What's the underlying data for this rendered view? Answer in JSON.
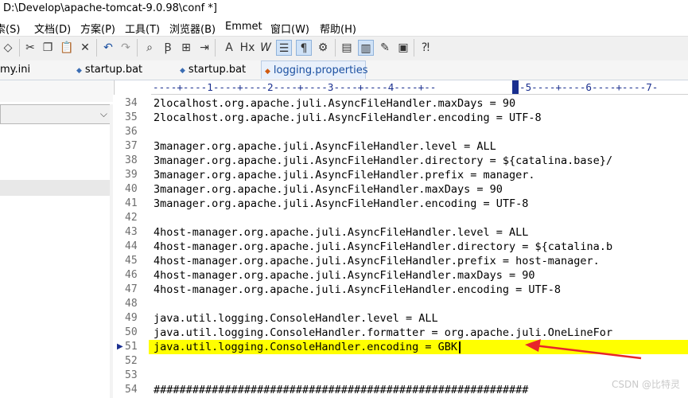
{
  "window": {
    "title": "D:\\Develop\\apache-tomcat-9.0.98\\conf *]"
  },
  "menu": [
    "索(S)",
    "文档(D)",
    "方案(P)",
    "工具(T)",
    "浏览器(B)",
    "Emmet",
    "窗口(W)",
    "帮助(H)"
  ],
  "tabs": [
    {
      "label": "my.ini"
    },
    {
      "label": "startup.bat"
    },
    {
      "label": "startup.bat"
    },
    {
      "label": "logging.properties"
    }
  ],
  "ruler": "----+----1----+----2----+----3----+----4----+--",
  "ruler_after": "-5----+----6----+----7-",
  "lines": [
    {
      "n": "34",
      "text": "2localhost.org.apache.juli.AsyncFileHandler.maxDays = 90"
    },
    {
      "n": "35",
      "text": "2localhost.org.apache.juli.AsyncFileHandler.encoding = UTF-8"
    },
    {
      "n": "36",
      "text": ""
    },
    {
      "n": "37",
      "text": "3manager.org.apache.juli.AsyncFileHandler.level = ALL"
    },
    {
      "n": "38",
      "text": "3manager.org.apache.juli.AsyncFileHandler.directory = ${catalina.base}/"
    },
    {
      "n": "39",
      "text": "3manager.org.apache.juli.AsyncFileHandler.prefix = manager."
    },
    {
      "n": "40",
      "text": "3manager.org.apache.juli.AsyncFileHandler.maxDays = 90"
    },
    {
      "n": "41",
      "text": "3manager.org.apache.juli.AsyncFileHandler.encoding = UTF-8"
    },
    {
      "n": "42",
      "text": ""
    },
    {
      "n": "43",
      "text": "4host-manager.org.apache.juli.AsyncFileHandler.level = ALL"
    },
    {
      "n": "44",
      "text": "4host-manager.org.apache.juli.AsyncFileHandler.directory = ${catalina.b"
    },
    {
      "n": "45",
      "text": "4host-manager.org.apache.juli.AsyncFileHandler.prefix = host-manager."
    },
    {
      "n": "46",
      "text": "4host-manager.org.apache.juli.AsyncFileHandler.maxDays = 90"
    },
    {
      "n": "47",
      "text": "4host-manager.org.apache.juli.AsyncFileHandler.encoding = UTF-8"
    },
    {
      "n": "48",
      "text": ""
    },
    {
      "n": "49",
      "text": "java.util.logging.ConsoleHandler.level = ALL"
    },
    {
      "n": "50",
      "text": "java.util.logging.ConsoleHandler.formatter = org.apache.juli.OneLineFor"
    },
    {
      "n": "51",
      "text": "java.util.logging.ConsoleHandler.encoding = GBK"
    },
    {
      "n": "52",
      "text": ""
    },
    {
      "n": "53",
      "text": ""
    },
    {
      "n": "54",
      "text": "##########################################################"
    }
  ],
  "highlight_line": "51",
  "highlight_color": "#ffff00",
  "annotation_color": "#e8252a",
  "watermark": "CSDN @比特灵"
}
